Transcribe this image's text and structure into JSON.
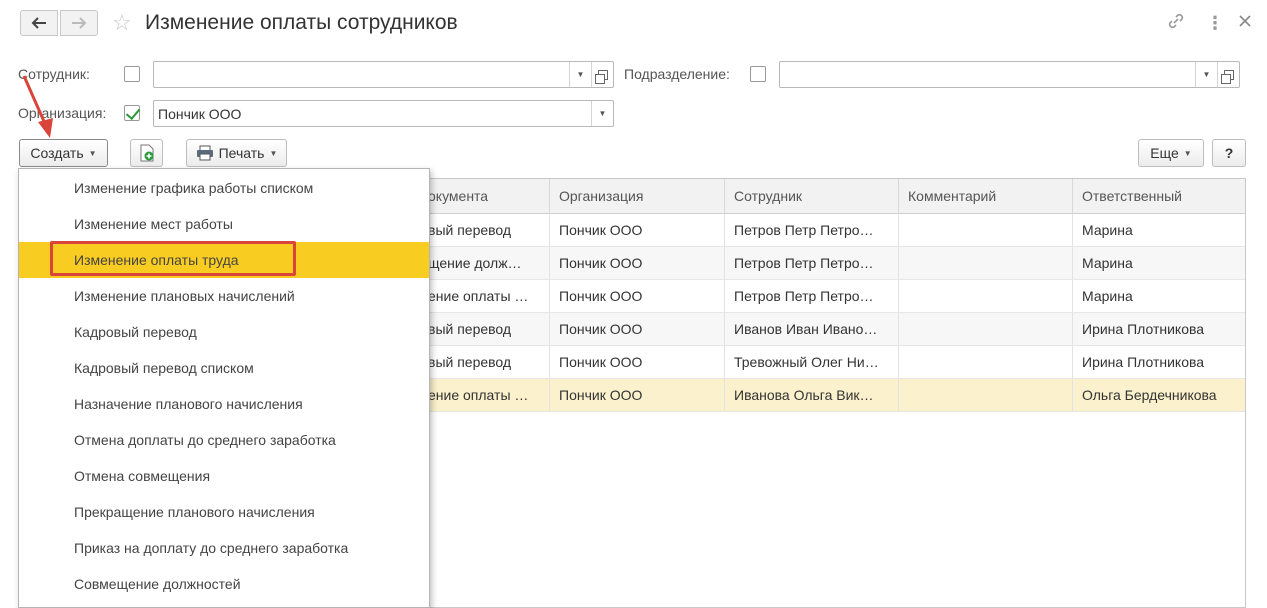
{
  "window": {
    "title": "Изменение оплаты сотрудников",
    "back_icon": "arrow-left-icon",
    "forward_icon": "arrow-right-icon",
    "favorite_icon": "star-icon",
    "link_icon": "link-icon",
    "more_icon": "more-vertical-icon",
    "close_icon": "close-icon"
  },
  "filters": {
    "employee": {
      "label": "Сотрудник:",
      "checked": false,
      "value": ""
    },
    "department": {
      "label": "Подразделение:",
      "checked": false,
      "value": ""
    },
    "organization": {
      "label": "Организация:",
      "checked": true,
      "value": "Пончик ООО"
    }
  },
  "toolbar": {
    "create_label": "Создать",
    "print_label": "Печать",
    "more_label": "Еще",
    "help_label": "?"
  },
  "table": {
    "columns": [
      "окумента",
      "Организация",
      "Сотрудник",
      "Комментарий",
      "Ответственный"
    ],
    "rows": [
      [
        "вый перевод",
        "Пончик ООО",
        "Петров Петр Петро…",
        "",
        "Марина"
      ],
      [
        "щение долж…",
        "Пончик ООО",
        "Петров Петр Петро…",
        "",
        "Марина"
      ],
      [
        "ение оплаты …",
        "Пончик ООО",
        "Петров Петр Петро…",
        "",
        "Марина"
      ],
      [
        "вый перевод",
        "Пончик ООО",
        "Иванов Иван Ивано…",
        "",
        "Ирина Плотникова"
      ],
      [
        "вый перевод",
        "Пончик ООО",
        "Тревожный Олег Ни…",
        "",
        "Ирина Плотникова"
      ],
      [
        "ение оплаты …",
        "Пончик ООО",
        "Иванова Ольга Вик…",
        "",
        "Ольга Бердечникова"
      ]
    ],
    "selected_row": 5
  },
  "create_menu": {
    "items": [
      "Изменение графика работы списком",
      "Изменение мест работы",
      "Изменение оплаты труда",
      "Изменение плановых начислений",
      "Кадровый перевод",
      "Кадровый перевод списком",
      "Назначение планового начисления",
      "Отмена доплаты до среднего заработка",
      "Отмена совмещения",
      "Прекращение планового начисления",
      "Приказ на доплату до среднего заработка",
      "Совмещение должностей"
    ],
    "highlighted_index": 2
  },
  "colors": {
    "menu_highlight": "#f9cc22",
    "annotation_red": "#d9453a",
    "selected_row": "#fbf1cc",
    "check_green": "#2a9a3a"
  }
}
